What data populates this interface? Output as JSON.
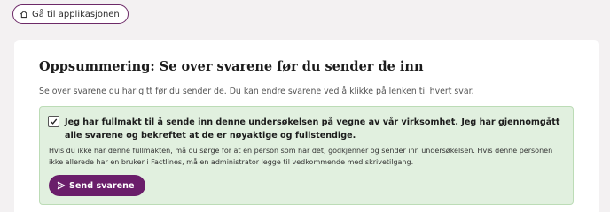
{
  "header": {
    "back_label": "Gå til applikasjonen",
    "back_icon": "home-icon"
  },
  "summary": {
    "title": "Oppsummering: Se over svarene før du sender de inn",
    "intro": "Se over svarene du har gitt før du sender de. Du kan endre svarene ved å klikke på lenken til hvert svar."
  },
  "confirmation": {
    "checked": true,
    "label": "Jeg har fullmakt til å sende inn denne undersøkelsen på vegne av vår virksomhet. Jeg har gjennomgått alle svarene og bekreftet at de er nøyaktige og fullstendige.",
    "help": "Hvis du ikke har denne fullmakten, må du sørge for at en person som har det, godkjenner og sender inn undersøkelsen. Hvis denne personen ikke allerede har en bruker i Factlines, må en administrator legge til vedkommende med skrivetilgang.",
    "send_label": "Send svarene",
    "send_icon": "send-icon"
  },
  "colors": {
    "accent": "#6a1e6a",
    "confirm_bg": "#e1f0df",
    "page_bg": "#f3f1f2"
  }
}
